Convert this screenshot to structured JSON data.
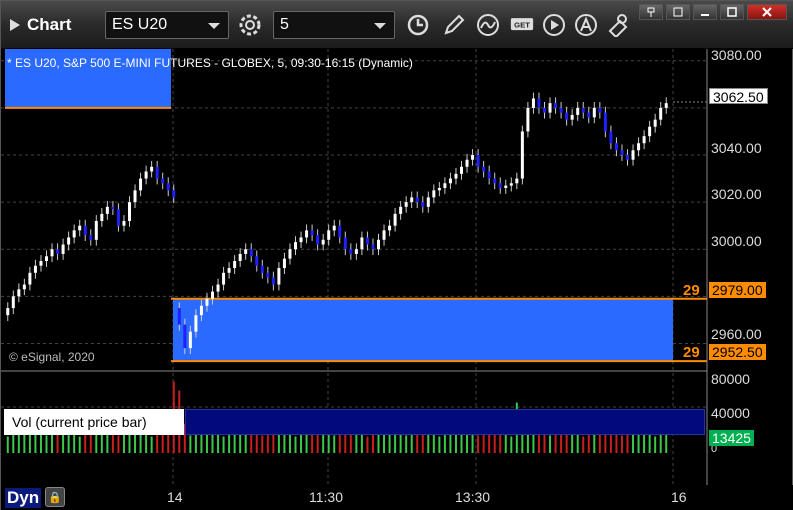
{
  "app": {
    "title": "Chart"
  },
  "toolbar": {
    "symbol": "ES U20",
    "interval": "5",
    "icons": [
      "gear-icon",
      "clock-icon",
      "pencil-icon",
      "curve-chart-icon",
      "get-data-icon",
      "play-icon",
      "alert-icon",
      "cursor-link-icon"
    ],
    "get_label": "GET"
  },
  "chart": {
    "header": "* ES U20, S&P 500 E-MINI FUTURES - GLOBEX, 5, 09:30-16:15 (Dynamic)",
    "copyright": "© eSignal, 2020",
    "price_axis": [
      "3080.00",
      "3060.00",
      "3040.00",
      "3020.00",
      "3000.00",
      "2980.00",
      "2960.00"
    ],
    "current_price": "3062.50",
    "level_upper": "2979.00",
    "level_lower": "2952.50",
    "level_upper_tag": "29",
    "level_lower_tag": "29",
    "volume_axis": [
      "80000",
      "40000",
      "0"
    ],
    "current_volume": "13425",
    "time_axis": [
      "14",
      "11:30",
      "13:30",
      "16"
    ],
    "colors": {
      "up": "#ffffff",
      "down": "#2020ff",
      "zone": "#2a6aff",
      "level": "#ff8c00",
      "vol_up": "#3cc84a",
      "vol_down": "#c82020"
    }
  },
  "study": {
    "label": "Vol (current price bar)",
    "close": "×"
  },
  "status": {
    "mode": "Dyn"
  },
  "chart_data": {
    "type": "candlestick",
    "title": "* ES U20, S&P 500 E-MINI FUTURES - GLOBEX, 5, 09:30-16:15 (Dynamic)",
    "ylim": [
      2950,
      3085
    ],
    "current_price": 3062.5,
    "levels": [
      2979.0,
      2952.5
    ],
    "closes": [
      2975,
      2980,
      2983,
      2985,
      2990,
      2993,
      2995,
      2997,
      3000,
      2998,
      3002,
      3005,
      3008,
      3010,
      3006,
      3004,
      3012,
      3015,
      3018,
      3017,
      3010,
      3012,
      3020,
      3025,
      3030,
      3033,
      3035,
      3030,
      3028,
      3025,
      3022,
      2968,
      2958,
      2965,
      2972,
      2976,
      2979,
      2982,
      2985,
      2990,
      2992,
      2995,
      2998,
      3000,
      2997,
      2993,
      2990,
      2988,
      2985,
      2992,
      2996,
      3000,
      3003,
      3005,
      3008,
      3006,
      3002,
      3004,
      3008,
      3010,
      3005,
      3000,
      2998,
      3000,
      3005,
      3002,
      3000,
      3004,
      3008,
      3010,
      3015,
      3018,
      3020,
      3022,
      3020,
      3018,
      3022,
      3025,
      3026,
      3028,
      3030,
      3032,
      3035,
      3038,
      3040,
      3035,
      3033,
      3030,
      3028,
      3026,
      3027,
      3028,
      3030,
      3050,
      3060,
      3064,
      3060,
      3058,
      3062,
      3060,
      3058,
      3055,
      3057,
      3060,
      3058,
      3056,
      3060,
      3058,
      3050,
      3045,
      3042,
      3040,
      3038,
      3042,
      3045,
      3048,
      3052,
      3055,
      3060,
      3062
    ],
    "volume_ylim": [
      0,
      85000
    ],
    "current_volume": 13425
  }
}
